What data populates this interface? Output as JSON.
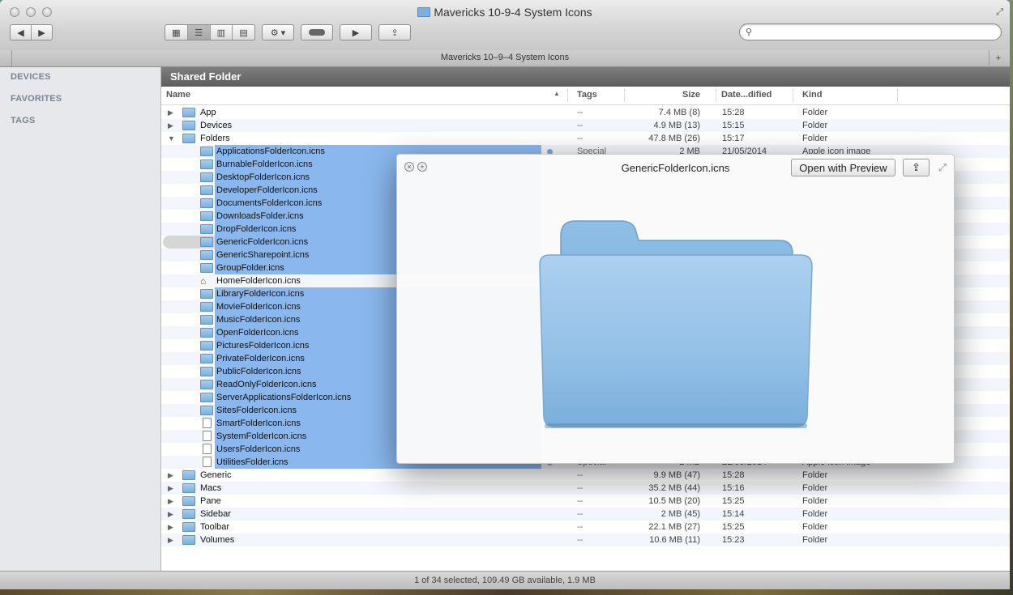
{
  "window": {
    "title": "Mavericks 10-9-4 System Icons",
    "tab_title": "Mavericks 10–9–4 System Icons",
    "status": "1 of 34 selected, 109.49 GB available, 1.9 MB"
  },
  "sidebar": {
    "sections": [
      "DEVICES",
      "FAVORITES",
      "TAGS"
    ]
  },
  "path_header": "Shared Folder",
  "columns": {
    "name": "Name",
    "tags": "Tags",
    "size": "Size",
    "date": "Date...dified",
    "kind": "Kind"
  },
  "rows": [
    {
      "name": "App",
      "tags": "--",
      "size": "7.4 MB (8)",
      "date": "15:28",
      "kind": "Folder"
    },
    {
      "name": "Devices",
      "tags": "--",
      "size": "4.9 MB (13)",
      "date": "15:15",
      "kind": "Folder"
    },
    {
      "name": "Folders",
      "tags": "--",
      "size": "47.8 MB (26)",
      "date": "15:17",
      "kind": "Folder"
    },
    {
      "name": "ApplicationsFolderIcon.icns",
      "tags": "Special",
      "size": "2 MB",
      "date": "21/05/2014",
      "kind": "Apple icon image"
    },
    {
      "name": "BurnableFolderIcon.icns"
    },
    {
      "name": "DesktopFolderIcon.icns"
    },
    {
      "name": "DeveloperFolderIcon.icns"
    },
    {
      "name": "DocumentsFolderIcon.icns"
    },
    {
      "name": "DownloadsFolder.icns"
    },
    {
      "name": "DropFolderIcon.icns"
    },
    {
      "name": "GenericFolderIcon.icns"
    },
    {
      "name": "GenericSharepoint.icns"
    },
    {
      "name": "GroupFolder.icns"
    },
    {
      "name": "HomeFolderIcon.icns"
    },
    {
      "name": "LibraryFolderIcon.icns"
    },
    {
      "name": "MovieFolderIcon.icns"
    },
    {
      "name": "MusicFolderIcon.icns"
    },
    {
      "name": "OpenFolderIcon.icns"
    },
    {
      "name": "PicturesFolderIcon.icns"
    },
    {
      "name": "PrivateFolderIcon.icns"
    },
    {
      "name": "PublicFolderIcon.icns"
    },
    {
      "name": "ReadOnlyFolderIcon.icns"
    },
    {
      "name": "ServerApplicationsFolderIcon.icns"
    },
    {
      "name": "SitesFolderIcon.icns"
    },
    {
      "name": "SmartFolderIcon.icns"
    },
    {
      "name": "SystemFolderIcon.icns"
    },
    {
      "name": "UsersFolderIcon.icns"
    },
    {
      "name": "UtilitiesFolder.icns",
      "tags": "Special",
      "size": "2 MB",
      "date": "21/05/2014",
      "kind": "Apple icon image"
    },
    {
      "name": "Generic",
      "tags": "--",
      "size": "9.9 MB (47)",
      "date": "15:28",
      "kind": "Folder"
    },
    {
      "name": "Macs",
      "tags": "--",
      "size": "35.2 MB (44)",
      "date": "15:16",
      "kind": "Folder"
    },
    {
      "name": "Pane",
      "tags": "--",
      "size": "10.5 MB (20)",
      "date": "15:25",
      "kind": "Folder"
    },
    {
      "name": "Sidebar",
      "tags": "--",
      "size": "2 MB (45)",
      "date": "15:14",
      "kind": "Folder"
    },
    {
      "name": "Toolbar",
      "tags": "--",
      "size": "22.1 MB (27)",
      "date": "15:25",
      "kind": "Folder"
    },
    {
      "name": "Volumes",
      "tags": "--",
      "size": "10.6 MB (11)",
      "date": "15:23",
      "kind": "Folder"
    }
  ],
  "quicklook": {
    "title": "GenericFolderIcon.icns",
    "open_label": "Open with Preview"
  },
  "colors": {
    "selection": "#8ab8ee",
    "folder_blue": "#7ab0de",
    "header_gray": "#6e6e6e"
  }
}
